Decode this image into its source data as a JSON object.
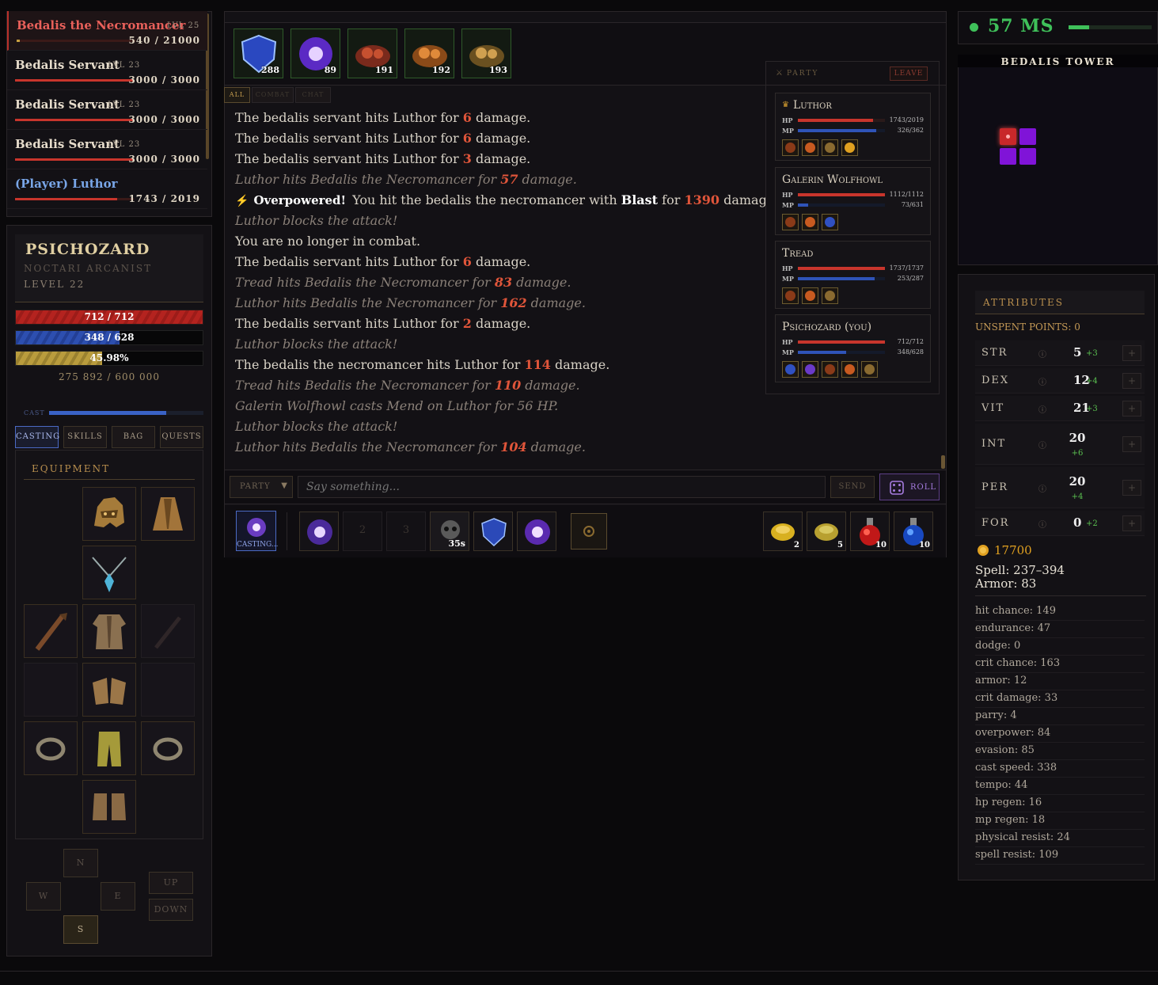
{
  "targets": [
    {
      "name": "Bedalis the Necromancer",
      "level": "LVL 25",
      "hp": "540 / 21000",
      "hp_frac": 0.026,
      "selected": true
    },
    {
      "name": "Bedalis Servant",
      "level": "LVL 23",
      "hp": "3000 / 3000",
      "hp_frac": 1
    },
    {
      "name": "Bedalis Servant",
      "level": "LVL 23",
      "hp": "3000 / 3000",
      "hp_frac": 1
    },
    {
      "name": "Bedalis Servant",
      "level": "LVL 23",
      "hp": "3000 / 3000",
      "hp_frac": 1
    },
    {
      "name": "(Player) Luthor",
      "level": "",
      "hp": "1743 / 2019",
      "hp_frac": 0.863
    }
  ],
  "character": {
    "name": "PSICHOZARD",
    "class": "NOCTARI ARCANIST",
    "level": "LEVEL 22",
    "hp": "712 / 712",
    "hp_frac": 1,
    "mp": "348 / 628",
    "mp_frac": 0.554,
    "xp": "45.98%",
    "xp_frac": 0.4598,
    "xp_total": "275 892 / 600 000",
    "cast_label": "CAST",
    "cast_frac": 0.76
  },
  "left_tabs": [
    "CASTING",
    "SKILLS",
    "BAG",
    "QUESTS"
  ],
  "equipment_title": "EQUIPMENT",
  "nav": {
    "n": "N",
    "w": "W",
    "e": "E",
    "s": "S",
    "up": "UP",
    "down": "DOWN"
  },
  "buffs": [
    {
      "count": "288",
      "icon": "shield-spell-icon"
    },
    {
      "count": "89",
      "icon": "arcane-orb-icon"
    },
    {
      "count": "191",
      "icon": "meat-food-icon"
    },
    {
      "count": "192",
      "icon": "roast-food-icon"
    },
    {
      "count": "193",
      "icon": "skewer-food-icon"
    }
  ],
  "log_tabs": [
    "ALL",
    "COMBAT",
    "CHAT"
  ],
  "log": [
    {
      "pre": "The bedalis servant hits Luthor for ",
      "num": "6",
      "post": " damage.",
      "style": "normal"
    },
    {
      "pre": "The bedalis servant hits Luthor for ",
      "num": "6",
      "post": " damage.",
      "style": "normal"
    },
    {
      "pre": "The bedalis servant hits Luthor for ",
      "num": "3",
      "post": " damage.",
      "style": "normal"
    },
    {
      "pre": "Luthor hits Bedalis the Necromancer for ",
      "num": "57",
      "post": " damage.",
      "style": "italic"
    },
    {
      "pre": "",
      "num": "",
      "post": "",
      "style": "overpower"
    },
    {
      "pre": "Luthor blocks the attack!",
      "num": "",
      "post": "",
      "style": "italic"
    },
    {
      "pre": "You are no longer in combat.",
      "num": "",
      "post": "",
      "style": "normal"
    },
    {
      "pre": "The bedalis servant hits Luthor for ",
      "num": "6",
      "post": " damage.",
      "style": "normal"
    },
    {
      "pre": "Tread hits Bedalis the Necromancer for ",
      "num": "83",
      "post": " damage.",
      "style": "italic"
    },
    {
      "pre": "Luthor hits Bedalis the Necromancer for ",
      "num": "162",
      "post": " damage.",
      "style": "italic"
    },
    {
      "pre": "The bedalis servant hits Luthor for ",
      "num": "2",
      "post": " damage.",
      "style": "normal"
    },
    {
      "pre": "Luthor blocks the attack!",
      "num": "",
      "post": "",
      "style": "italic"
    },
    {
      "pre": "The bedalis the necromancer hits Luthor for ",
      "num": "114",
      "post": " damage.",
      "style": "normal"
    },
    {
      "pre": "Tread hits Bedalis the Necromancer for ",
      "num": "110",
      "post": " damage.",
      "style": "italic"
    },
    {
      "pre": "Galerin Wolfhowl casts Mend on Luthor for 56 HP.",
      "num": "",
      "post": "",
      "style": "italic"
    },
    {
      "pre": "Luthor blocks the attack!",
      "num": "",
      "post": "",
      "style": "italic"
    },
    {
      "pre": "Luthor hits Bedalis the Necromancer for ",
      "num": "104",
      "post": " damage.",
      "style": "italic"
    }
  ],
  "overpower": {
    "tag": "Overpowered!",
    "a": "You hit the bedalis the necromancer with ",
    "spell": "Blast",
    "b": " for ",
    "num": "1390",
    "c": " damage."
  },
  "party": {
    "title": "PARTY",
    "leave": "LEAVE",
    "members": [
      {
        "name": "Luthor",
        "crown": true,
        "hp": "1743/2019",
        "mp": "326/362",
        "hp_frac": 0.863,
        "mp_frac": 0.9
      },
      {
        "name": "Galerin Wolfhowl",
        "crown": false,
        "hp": "1112/1112",
        "mp": "73/631",
        "hp_frac": 1,
        "mp_frac": 0.116
      },
      {
        "name": "Tread",
        "crown": false,
        "hp": "1737/1737",
        "mp": "253/287",
        "hp_frac": 1,
        "mp_frac": 0.88
      },
      {
        "name": "Psichozard (you)",
        "crown": false,
        "hp": "712/712",
        "mp": "348/628",
        "hp_frac": 1,
        "mp_frac": 0.554
      }
    ],
    "hp_label": "HP",
    "mp_label": "MP"
  },
  "chat": {
    "channel": "PARTY",
    "placeholder": "Say something...",
    "send": "SEND",
    "roll": "ROLL"
  },
  "actionbar": {
    "casting": "CASTING...",
    "slot2": "2",
    "slot3": "3",
    "cooldown": "35s",
    "items": [
      {
        "count": "2"
      },
      {
        "count": "5"
      },
      {
        "count": "10"
      },
      {
        "count": "10"
      }
    ]
  },
  "ping": {
    "value": "57 MS",
    "frac": 0.25
  },
  "map": {
    "title": "BEDALIS TOWER"
  },
  "attributes": {
    "title": "ATTRIBUTES",
    "unspent": "UNSPENT POINTS: 0",
    "rows": [
      {
        "key": "STR",
        "val": "5",
        "bonus": "+3"
      },
      {
        "key": "DEX",
        "val": "12",
        "bonus": "+4"
      },
      {
        "key": "VIT",
        "val": "21",
        "bonus": "+3"
      },
      {
        "key": "INT",
        "val": "20",
        "bonus": "+6"
      },
      {
        "key": "PER",
        "val": "20",
        "bonus": "+4"
      },
      {
        "key": "FOR",
        "val": "0",
        "bonus": "+2"
      }
    ],
    "gold": "17700",
    "spell": "Spell: 237–394",
    "armor": "Armor: 83",
    "stats": [
      "hit chance: 149",
      "endurance: 47",
      "dodge: 0",
      "crit chance: 163",
      "armor: 12",
      "crit damage: 33",
      "parry: 4",
      "overpower: 84",
      "evasion: 85",
      "cast speed: 338",
      "tempo: 44",
      "hp regen: 16",
      "mp regen: 18",
      "physical resist: 24",
      "spell resist: 109"
    ]
  },
  "colors": {
    "hp": "#c8352c",
    "mp": "#2f53b8",
    "xp": "#b49a3e",
    "gold": "#c59a56",
    "ping": "#3fc05a"
  }
}
